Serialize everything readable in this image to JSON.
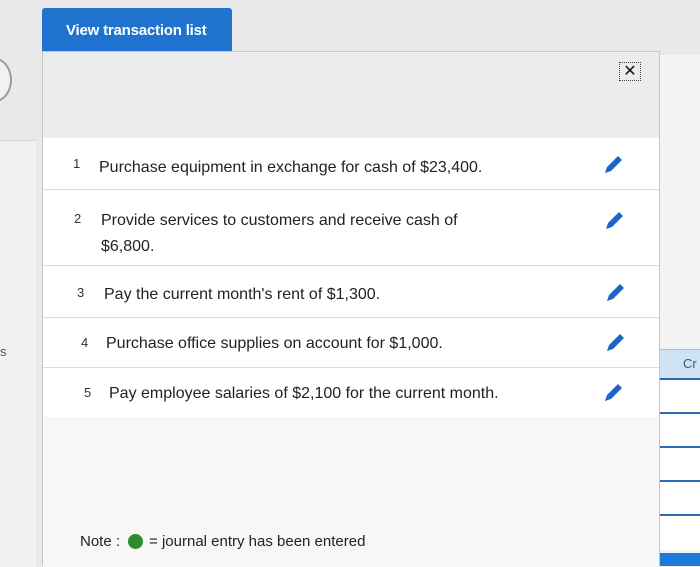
{
  "tab": {
    "label": "View transaction list"
  },
  "close_label": "✕",
  "transactions": [
    {
      "num": "1",
      "text": "Purchase equipment in exchange for cash of $23,400."
    },
    {
      "num": "2",
      "text": "Provide services to customers and receive cash of $6,800."
    },
    {
      "num": "3",
      "text": "Pay the current month's rent of $1,300."
    },
    {
      "num": "4",
      "text": "Purchase office supplies on account for $1,000."
    },
    {
      "num": "5",
      "text": "Pay employee salaries of $2,100 for the current month."
    }
  ],
  "note": {
    "label": "Note :",
    "legend_text": "= journal entry has been entered"
  },
  "background": {
    "right_header_label": "Cr",
    "left_label": "s"
  },
  "colors": {
    "tab_blue": "#1f73cf",
    "pencil_blue": "#1c65c9",
    "entered_green": "#2e8b2e"
  }
}
